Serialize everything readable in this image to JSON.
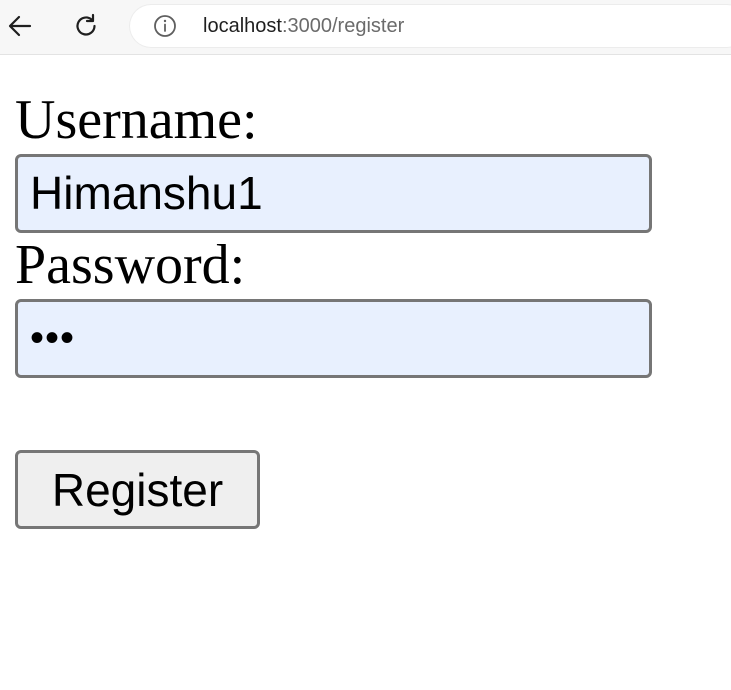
{
  "browser": {
    "url_host": "localhost",
    "url_path": ":3000/register",
    "back_icon": "back-arrow-icon",
    "reload_icon": "reload-icon",
    "info_icon": "info-icon"
  },
  "form": {
    "username_label": "Username:",
    "username_value": "Himanshu1",
    "password_label": "Password:",
    "password_masked": "•••",
    "register_label": "Register"
  },
  "colors": {
    "autofill_background": "#e8f0fe",
    "input_border": "#767676",
    "button_background": "#efefef"
  }
}
